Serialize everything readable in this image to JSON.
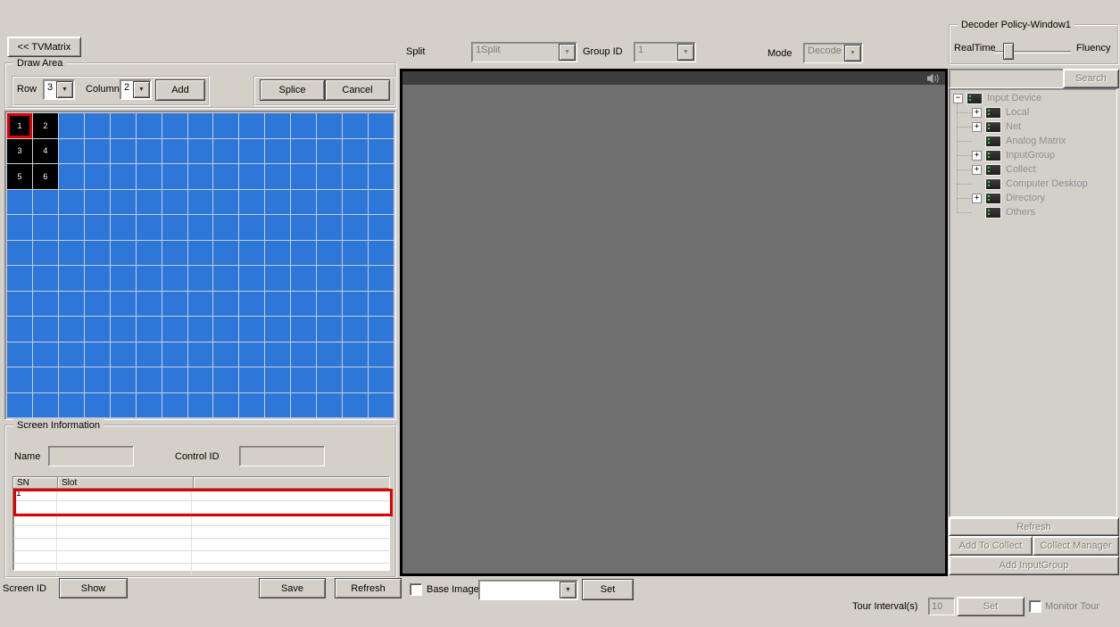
{
  "toolbar": {
    "tvmatrix_label": "<< TVMatrix"
  },
  "draw_area": {
    "title": "Draw Area",
    "row_label": "Row",
    "row_value": "3",
    "column_label": "Column",
    "column_value": "2",
    "add_label": "Add",
    "splice_label": "Splice",
    "cancel_label": "Cancel"
  },
  "grid": {
    "rows": 12,
    "cols": 15,
    "colors": {
      "cell_blue": "#2d77d8",
      "gridline": "#c6cdda",
      "screen_black": "#000000",
      "selection_red": "#e10000"
    },
    "numbered_cells": [
      {
        "n": "1",
        "row": 0,
        "col": 0,
        "selected": true
      },
      {
        "n": "2",
        "row": 0,
        "col": 1,
        "selected": false
      },
      {
        "n": "3",
        "row": 1,
        "col": 0,
        "selected": false
      },
      {
        "n": "4",
        "row": 1,
        "col": 1,
        "selected": false
      },
      {
        "n": "5",
        "row": 2,
        "col": 0,
        "selected": false
      },
      {
        "n": "6",
        "row": 2,
        "col": 1,
        "selected": false
      }
    ]
  },
  "screen_info": {
    "title": "Screen Information",
    "name_label": "Name",
    "name_value": "",
    "control_id_label": "Control ID",
    "control_id_value": "",
    "table": {
      "headers": [
        "SN",
        "Slot",
        ""
      ],
      "rows": [
        [
          "1",
          "",
          ""
        ],
        [
          "",
          "",
          ""
        ],
        [
          "",
          "",
          ""
        ],
        [
          "",
          "",
          ""
        ],
        [
          "",
          "",
          ""
        ],
        [
          "",
          "",
          ""
        ],
        [
          "",
          "",
          ""
        ]
      ],
      "highlighted_row": 0
    }
  },
  "bottom_bar": {
    "screen_id_label": "Screen ID",
    "show_label": "Show",
    "save_label": "Save",
    "refresh_label": "Refresh"
  },
  "split_bar": {
    "split_label": "Split",
    "split_value": "1Split",
    "group_id_label": "Group ID",
    "group_id_value": "1",
    "mode_label": "Mode",
    "mode_value": "Decode"
  },
  "video": {
    "speaker_icon": "speaker-icon",
    "body_color": "#6f6f6f",
    "titlebar_color": "#3e3e3e"
  },
  "base_image": {
    "label": "Base Image",
    "checked": false,
    "combo_value": "",
    "set_label": "Set"
  },
  "decoder_policy": {
    "title": "Decoder Policy-Window1",
    "realtime_label": "RealTime",
    "fluency_label": "Fluency"
  },
  "search": {
    "input_value": "",
    "button_label": "Search"
  },
  "tree": {
    "items": [
      {
        "label": "Input Device",
        "expand": "minus",
        "level": 0
      },
      {
        "label": "Local",
        "expand": "plus",
        "level": 1
      },
      {
        "label": "Net",
        "expand": "plus",
        "level": 1
      },
      {
        "label": "Analog Matrix",
        "expand": "none",
        "level": 1
      },
      {
        "label": "InputGroup",
        "expand": "plus",
        "level": 1
      },
      {
        "label": "Collect",
        "expand": "plus",
        "level": 1
      },
      {
        "label": "Computer Desktop",
        "expand": "none",
        "level": 1
      },
      {
        "label": "Directory",
        "expand": "plus",
        "level": 1
      },
      {
        "label": "Others",
        "expand": "none",
        "level": 1
      }
    ]
  },
  "right_buttons": {
    "refresh_label": "Refresh",
    "add_to_collect_label": "Add To Collect",
    "collect_manager_label": "Collect Manager",
    "add_input_group_label": "Add InputGroup"
  },
  "tour": {
    "label": "Tour Interval(s)",
    "interval_value": "10",
    "set_label": "Set",
    "monitor_label": "Monitor Tour",
    "monitor_checked": false
  }
}
